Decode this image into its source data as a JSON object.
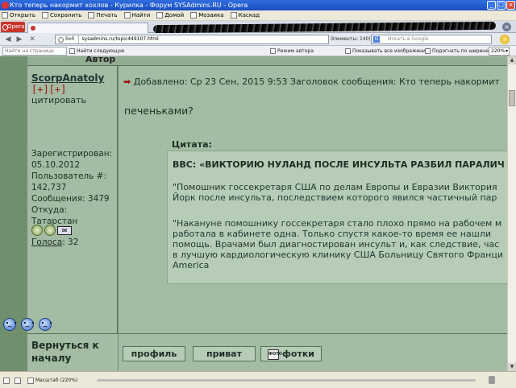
{
  "window": {
    "title": "Кто теперь накормит хохлов - Курилка - Форум SYSAdmins.RU - Opera",
    "minimize": "_",
    "maximize": "□",
    "close": "×"
  },
  "menu": {
    "items": [
      "Открыть",
      "Сохранить",
      "Печать",
      "Найти",
      "Домой",
      "Мозаика",
      "Каскад"
    ]
  },
  "tabs": {
    "opera_label": "Opera",
    "close_all": "×"
  },
  "address": {
    "back": "◀",
    "forward": "▶",
    "reload": "✕",
    "web_label": "Веб",
    "url": "sysadmins.ru/topic449107.html",
    "elements": "Элементы: 140(14)",
    "search_engine": "G",
    "search_placeholder": "Искать в Google"
  },
  "toolbar": {
    "find_placeholder": "Найти на странице",
    "find_next": "Найти следующую",
    "author_mode": "Режим автора",
    "show_images": "Показывать все изображения",
    "fit_width": "Подогнать по ширине",
    "zoom": "220%"
  },
  "post": {
    "header_partial": "Автор",
    "username": "ScorpAnatoly",
    "plus": "[+][+]",
    "quote_link": "цитировать",
    "info": [
      "Зарегистрирован:",
      "05.10.2012",
      "Пользователь #:",
      "142,737",
      "Сообщения: 3479",
      "Откуда:",
      "Татарстан"
    ],
    "pm_label": "✉",
    "votes_label": "Голоса",
    "votes_value": ": 32",
    "meta_arrow": "➡",
    "meta": "Добавлено: Ср 23 Сен, 2015 9:53    Заголовок сообщения: Кто теперь накормит",
    "body": "печеньками?",
    "quote_label": "Цитата:",
    "quote_head": "BBC: «ВИКТОРИЮ НУЛАНД ПОСЛЕ ИНСУЛЬТА РАЗБИЛ ПАРАЛИЧ",
    "quote_p1": [
      "\"Помошник госсекретаря США по делам Европы и Евразии Виктория",
      "Йорк после инсульта, последствием которого явился частичный пар"
    ],
    "quote_p2": [
      "\"Накануне помошнику госсекретаря стало плохо прямо на рабочем м",
      "работала в кабинете одна. Только спустя какое-то время ее нашли",
      "помощь. Врачами был диагностирован инсульт и, как следствие, час",
      "в лучшую кардиологическую клинику США Больницу Святого Франци",
      "America"
    ],
    "back_to_top": "Вернуться к\nначалу",
    "btn_profile": "профиль",
    "btn_private": "приват",
    "btn_photos": "фотки",
    "photo_icon_text": "ФОТО"
  },
  "status": {
    "zoom_label": "Масштаб (220%)"
  }
}
